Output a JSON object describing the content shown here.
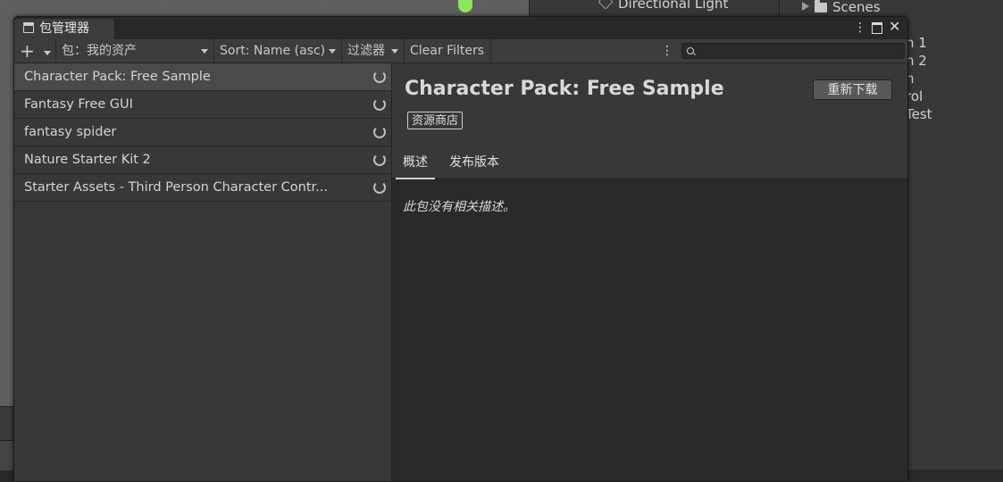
{
  "background": {
    "hierarchy_item": "Directional Light",
    "project_folder": "Scenes",
    "side_fragments": [
      "n 1",
      "n 2",
      "n",
      "rol",
      "Test"
    ]
  },
  "window": {
    "title": "包管理器",
    "menu_icon": "vertical-ellipsis-icon",
    "maximize_icon": "maximize-icon",
    "close_icon": "close-icon"
  },
  "toolbar": {
    "add_label": "+",
    "packages_dropdown": "包：我的资产",
    "sort_dropdown": "Sort: Name (asc)",
    "filters_dropdown": "过滤器",
    "clear_filters": "Clear Filters",
    "search_value": ""
  },
  "packages": [
    {
      "name": "Character Pack: Free Sample",
      "selected": true
    },
    {
      "name": "Fantasy Free GUI",
      "selected": false
    },
    {
      "name": "fantasy spider",
      "selected": false
    },
    {
      "name": "Nature Starter Kit 2",
      "selected": false
    },
    {
      "name": "Starter Assets - Third Person Character Contr...",
      "selected": false
    }
  ],
  "detail": {
    "title": "Character Pack: Free Sample",
    "redownload_label": "重新下载",
    "source_badge": "资源商店",
    "tabs": [
      {
        "label": "概述",
        "active": true
      },
      {
        "label": "发布版本",
        "active": false
      }
    ],
    "description": "此包没有相关描述。"
  },
  "colors": {
    "window_bg": "#282828",
    "list_bg": "#383838",
    "selected_row": "#4a4a4a",
    "detail_bg": "#2b292c"
  }
}
